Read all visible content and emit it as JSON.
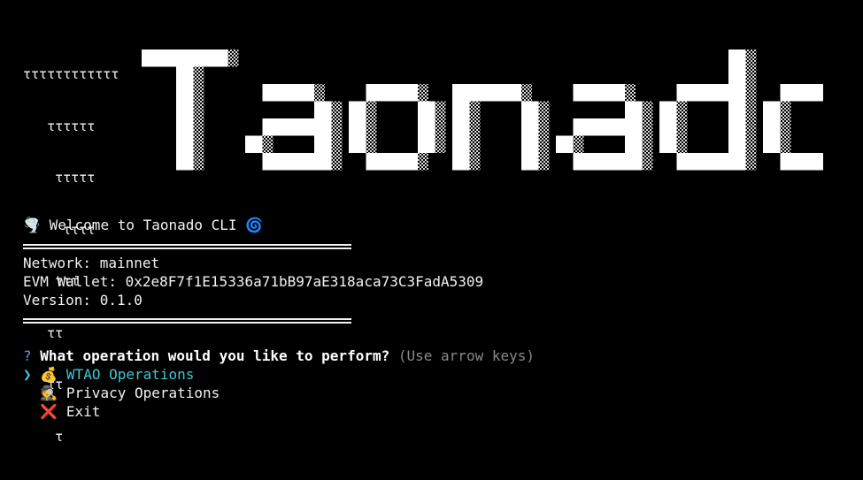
{
  "logo": {
    "lines": [
      "ττττττττττττ",
      "   ττττττ",
      "    τττττ",
      "     ττττ",
      "    τττ",
      "   ττ",
      "   ττ",
      "    τ"
    ]
  },
  "banner": {
    "text": "Taonado"
  },
  "welcome": {
    "icon_left": "🌪️",
    "text": "Welcome to Taonado CLI",
    "icon_right": "🌀"
  },
  "info": {
    "network_label": "Network: ",
    "network_value": "mainnet",
    "wallet_label": "EVM Wallet: ",
    "wallet_value": "0x2e8F7f1E15336a71bB97aE318aca73C3FadA5309",
    "version_label": "Version: ",
    "version_value": "0.1.0"
  },
  "prompt": {
    "qmark": "?",
    "question": "What operation would you like to perform?",
    "hint": "(Use arrow keys)"
  },
  "menu": {
    "pointer": "❯",
    "items": [
      {
        "icon": "💰",
        "label": "WTAO Operations",
        "selected": true
      },
      {
        "icon": "🕵️",
        "label": "Privacy Operations",
        "selected": false
      },
      {
        "icon": "❌",
        "label": "Exit",
        "selected": false
      }
    ]
  },
  "colors": {
    "background": "#000000",
    "foreground": "#f2f2f2",
    "accent": "#3fc7d4",
    "qmark": "#7b8cf5",
    "hint": "#8a8a8a"
  }
}
